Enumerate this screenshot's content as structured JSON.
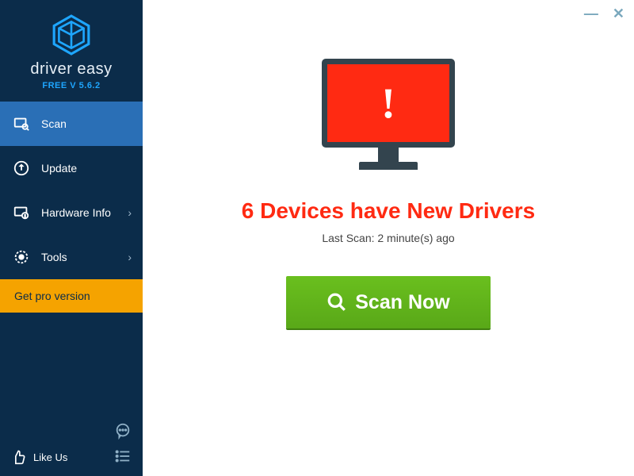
{
  "brand": {
    "name": "driver easy",
    "version": "FREE V 5.6.2"
  },
  "sidebar": {
    "items": [
      {
        "label": "Scan"
      },
      {
        "label": "Update"
      },
      {
        "label": "Hardware Info"
      },
      {
        "label": "Tools"
      }
    ],
    "pro_label": "Get pro version",
    "likeus_label": "Like Us"
  },
  "main": {
    "headline": "6 Devices have New Drivers",
    "subline": "Last Scan: 2 minute(s) ago",
    "scan_button": "Scan Now"
  }
}
